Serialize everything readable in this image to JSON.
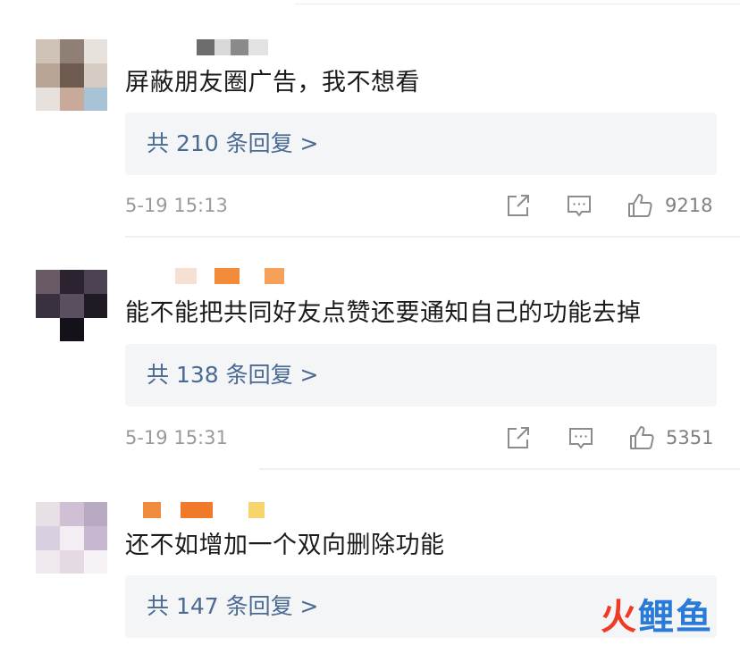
{
  "comments": [
    {
      "text": "屏蔽朋友圈广告，我不想看",
      "replies": "共 210 条回复 >",
      "time": "5-19 15:13",
      "likes": "9218"
    },
    {
      "text": "能不能把共同好友点赞还要通知自己的功能去掉",
      "replies": "共 138 条回复 >",
      "time": "5-19 15:31",
      "likes": "5351"
    },
    {
      "text": "还不如增加一个双向删除功能",
      "replies": "共 147 条回复 >",
      "time": "",
      "likes": ""
    }
  ],
  "watermark": {
    "text": "火鲤鱼",
    "color_1": "#f03a26",
    "color_2": "#2a7bd8"
  },
  "colors": {
    "reply_link": "#4a6a94",
    "reply_bg": "#f4f5f7",
    "meta": "#9a9a9a"
  }
}
